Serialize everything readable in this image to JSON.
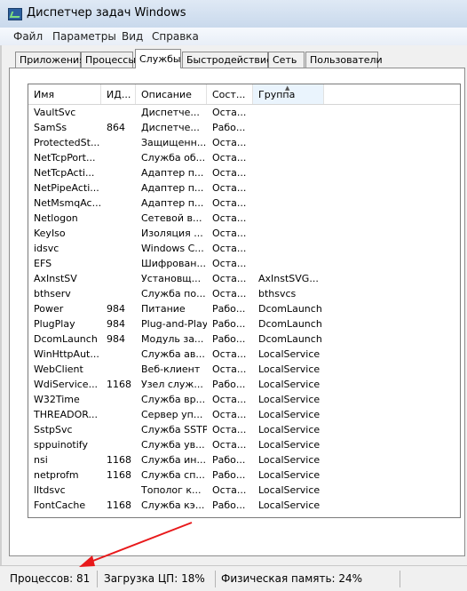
{
  "window": {
    "title": "Диспетчер задач Windows"
  },
  "menu": [
    "Файл",
    "Параметры",
    "Вид",
    "Справка"
  ],
  "tabs": [
    {
      "label": "Приложения",
      "active": false
    },
    {
      "label": "Процессы",
      "active": false
    },
    {
      "label": "Службы",
      "active": true
    },
    {
      "label": "Быстродействие",
      "active": false
    },
    {
      "label": "Сеть",
      "active": false
    },
    {
      "label": "Пользователи",
      "active": false
    }
  ],
  "columns": [
    "Имя",
    "ИД...",
    "Описание",
    "Сост...",
    "Группа"
  ],
  "sorted_column": "Группа",
  "services": [
    {
      "name": "VaultSvc",
      "pid": "",
      "description": "Диспетче...",
      "status": "Оста...",
      "group": ""
    },
    {
      "name": "SamSs",
      "pid": "864",
      "description": "Диспетче...",
      "status": "Рабо...",
      "group": ""
    },
    {
      "name": "ProtectedSt...",
      "pid": "",
      "description": "Защищенн...",
      "status": "Оста...",
      "group": ""
    },
    {
      "name": "NetTcpPort...",
      "pid": "",
      "description": "Служба об...",
      "status": "Оста...",
      "group": ""
    },
    {
      "name": "NetTcpActi...",
      "pid": "",
      "description": "Адаптер п...",
      "status": "Оста...",
      "group": ""
    },
    {
      "name": "NetPipeActi...",
      "pid": "",
      "description": "Адаптер п...",
      "status": "Оста...",
      "group": ""
    },
    {
      "name": "NetMsmqAc...",
      "pid": "",
      "description": "Адаптер п...",
      "status": "Оста...",
      "group": ""
    },
    {
      "name": "Netlogon",
      "pid": "",
      "description": "Сетевой в...",
      "status": "Оста...",
      "group": ""
    },
    {
      "name": "KeyIso",
      "pid": "",
      "description": "Изоляция ...",
      "status": "Оста...",
      "group": ""
    },
    {
      "name": "idsvc",
      "pid": "",
      "description": "Windows C...",
      "status": "Оста...",
      "group": ""
    },
    {
      "name": "EFS",
      "pid": "",
      "description": "Шифрован...",
      "status": "Оста...",
      "group": ""
    },
    {
      "name": "AxInstSV",
      "pid": "",
      "description": "Установщ...",
      "status": "Оста...",
      "group": "AxInstSVG..."
    },
    {
      "name": "bthserv",
      "pid": "",
      "description": "Служба по...",
      "status": "Оста...",
      "group": "bthsvcs"
    },
    {
      "name": "Power",
      "pid": "984",
      "description": "Питание",
      "status": "Рабо...",
      "group": "DcomLaunch"
    },
    {
      "name": "PlugPlay",
      "pid": "984",
      "description": "Plug-and-Play",
      "status": "Рабо...",
      "group": "DcomLaunch"
    },
    {
      "name": "DcomLaunch",
      "pid": "984",
      "description": "Модуль за...",
      "status": "Рабо...",
      "group": "DcomLaunch"
    },
    {
      "name": "WinHttpAut...",
      "pid": "",
      "description": "Служба ав...",
      "status": "Оста...",
      "group": "LocalService"
    },
    {
      "name": "WebClient",
      "pid": "",
      "description": "Веб-клиент",
      "status": "Оста...",
      "group": "LocalService"
    },
    {
      "name": "WdiService...",
      "pid": "1168",
      "description": "Узел служ...",
      "status": "Рабо...",
      "group": "LocalService"
    },
    {
      "name": "W32Time",
      "pid": "",
      "description": "Служба вр...",
      "status": "Оста...",
      "group": "LocalService"
    },
    {
      "name": "THREADOR...",
      "pid": "",
      "description": "Сервер уп...",
      "status": "Оста...",
      "group": "LocalService"
    },
    {
      "name": "SstpSvc",
      "pid": "",
      "description": "Служба SSTP",
      "status": "Оста...",
      "group": "LocalService"
    },
    {
      "name": "sppuinotify",
      "pid": "",
      "description": "Служба ув...",
      "status": "Оста...",
      "group": "LocalService"
    },
    {
      "name": "nsi",
      "pid": "1168",
      "description": "Служба ин...",
      "status": "Рабо...",
      "group": "LocalService"
    },
    {
      "name": "netprofm",
      "pid": "1168",
      "description": "Служба сп...",
      "status": "Рабо...",
      "group": "LocalService"
    },
    {
      "name": "lltdsvc",
      "pid": "",
      "description": "Тополог к...",
      "status": "Оста...",
      "group": "LocalService"
    },
    {
      "name": "FontCache",
      "pid": "1168",
      "description": "Служба кэ...",
      "status": "Рабо...",
      "group": "LocalService"
    }
  ],
  "status_bar": {
    "processes": "Процессов: 81",
    "cpu": "Загрузка ЦП: 18%",
    "memory": "Физическая память: 24%"
  },
  "icons": {
    "app": "task-manager-icon",
    "sort": "sort-ascending-icon",
    "annotation": "red-arrow-icon"
  },
  "colors": {
    "annotation_arrow": "#e8191b",
    "sorted_header": "#eaf4fd"
  }
}
